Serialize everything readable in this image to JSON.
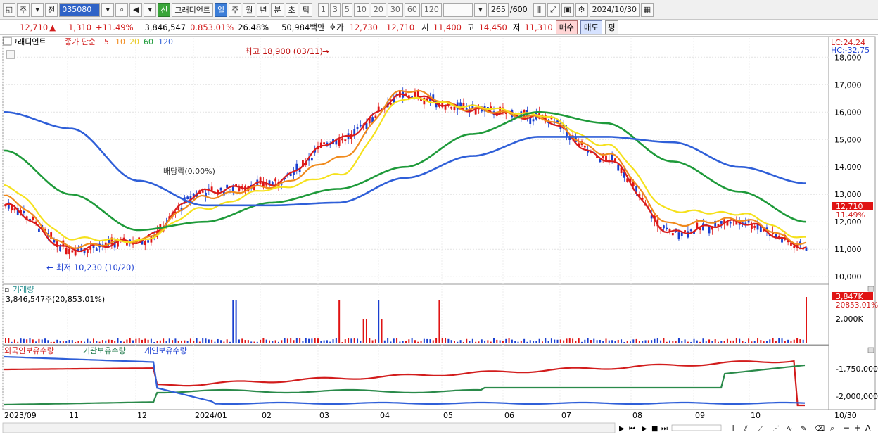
{
  "toolbar": {
    "market": "주",
    "range": "전",
    "code": "035080",
    "new_label": "신",
    "chart_style": "그래디언트",
    "periods": [
      "일",
      "주",
      "월",
      "년",
      "분",
      "초",
      "틱"
    ],
    "intervals": [
      "1",
      "3",
      "5",
      "10",
      "20",
      "30",
      "60",
      "120"
    ],
    "count": "265",
    "count_max": "/600",
    "date": "2024/10/30"
  },
  "ticker": {
    "price": "12,710",
    "change": "1,310",
    "change_pct": "+11.49%",
    "volume": "3,846,547",
    "vol_ratio": "0.853.01%",
    "turnover": "26.48%",
    "amount": "50,984백만",
    "quote_label": "호가",
    "ask": "12,730",
    "bid": "12,710",
    "open_label": "시",
    "open": "11,400",
    "high_label": "고",
    "high": "14,450",
    "low_label": "저",
    "low": "11,310",
    "buy": "매수",
    "sell": "매도",
    "avg": "평"
  },
  "price_panel": {
    "title": "그래디언트",
    "ma_label": "종가 단순",
    "ma_periods": [
      "5",
      "10",
      "20",
      "60",
      "120"
    ],
    "lc": "LC:24.24",
    "hc": "HC:-32.75",
    "high_note": "최고 18,900 (03/11)",
    "low_note": "최저 10,230 (10/20)",
    "dividend_note": "배당락(0.00%)",
    "current_price": "12,710",
    "current_pct": "11.49%",
    "y_ticks": [
      "18,000",
      "17,000",
      "16,000",
      "15,000",
      "14,000",
      "13,000",
      "12,000",
      "11,000",
      "10,000"
    ]
  },
  "volume_panel": {
    "title": "거래량",
    "value_label": "3,846,547주(20,853.01%)",
    "current_badge": "3,847K",
    "current_pct": "20853.01%",
    "y_tick": "2,000K"
  },
  "holdings_panel": {
    "series_labels": [
      "외국인보유수량",
      "기관보유수량",
      "개인보유수량"
    ],
    "y_ticks": [
      "-1,750,000",
      "-2,000,000"
    ]
  },
  "x_axis": {
    "labels": [
      "2023/09",
      "11",
      "12",
      "2024/01",
      "02",
      "03",
      "04",
      "05",
      "06",
      "07",
      "08",
      "09",
      "10"
    ],
    "last": "10/30"
  },
  "colors": {
    "up": "#e01414",
    "down": "#1a3fd0",
    "ma5": "#d81c1c",
    "ma10": "#f08a1c",
    "ma20": "#f5e11c",
    "ma60": "#1e9a3a",
    "ma120": "#2f5fd8"
  },
  "chart_data": {
    "type": "line",
    "x": [
      "2023/09",
      "11",
      "12",
      "2024/01",
      "02",
      "03",
      "04",
      "05",
      "06",
      "07",
      "08",
      "09",
      "10"
    ],
    "ylim": [
      10000,
      18500
    ],
    "series": [
      {
        "name": "5",
        "values": [
          12600,
          11000,
          11300,
          13100,
          13400,
          15000,
          16600,
          16100,
          15800,
          14300,
          11600,
          12000,
          11100
        ]
      },
      {
        "name": "10",
        "values": [
          12900,
          11100,
          11300,
          12900,
          13300,
          14300,
          16800,
          16100,
          15800,
          14500,
          11900,
          12100,
          11200
        ]
      },
      {
        "name": "20",
        "values": [
          13300,
          11400,
          11300,
          12500,
          13200,
          13700,
          16500,
          16200,
          15900,
          14800,
          12400,
          12300,
          11400
        ]
      },
      {
        "name": "60",
        "values": [
          14600,
          13000,
          11700,
          12000,
          12700,
          13200,
          14000,
          15200,
          16000,
          15600,
          14200,
          13100,
          12000
        ]
      },
      {
        "name": "120",
        "values": [
          16000,
          15400,
          13500,
          12600,
          12600,
          12700,
          13600,
          14400,
          15100,
          15100,
          14900,
          14000,
          13400
        ]
      }
    ]
  }
}
